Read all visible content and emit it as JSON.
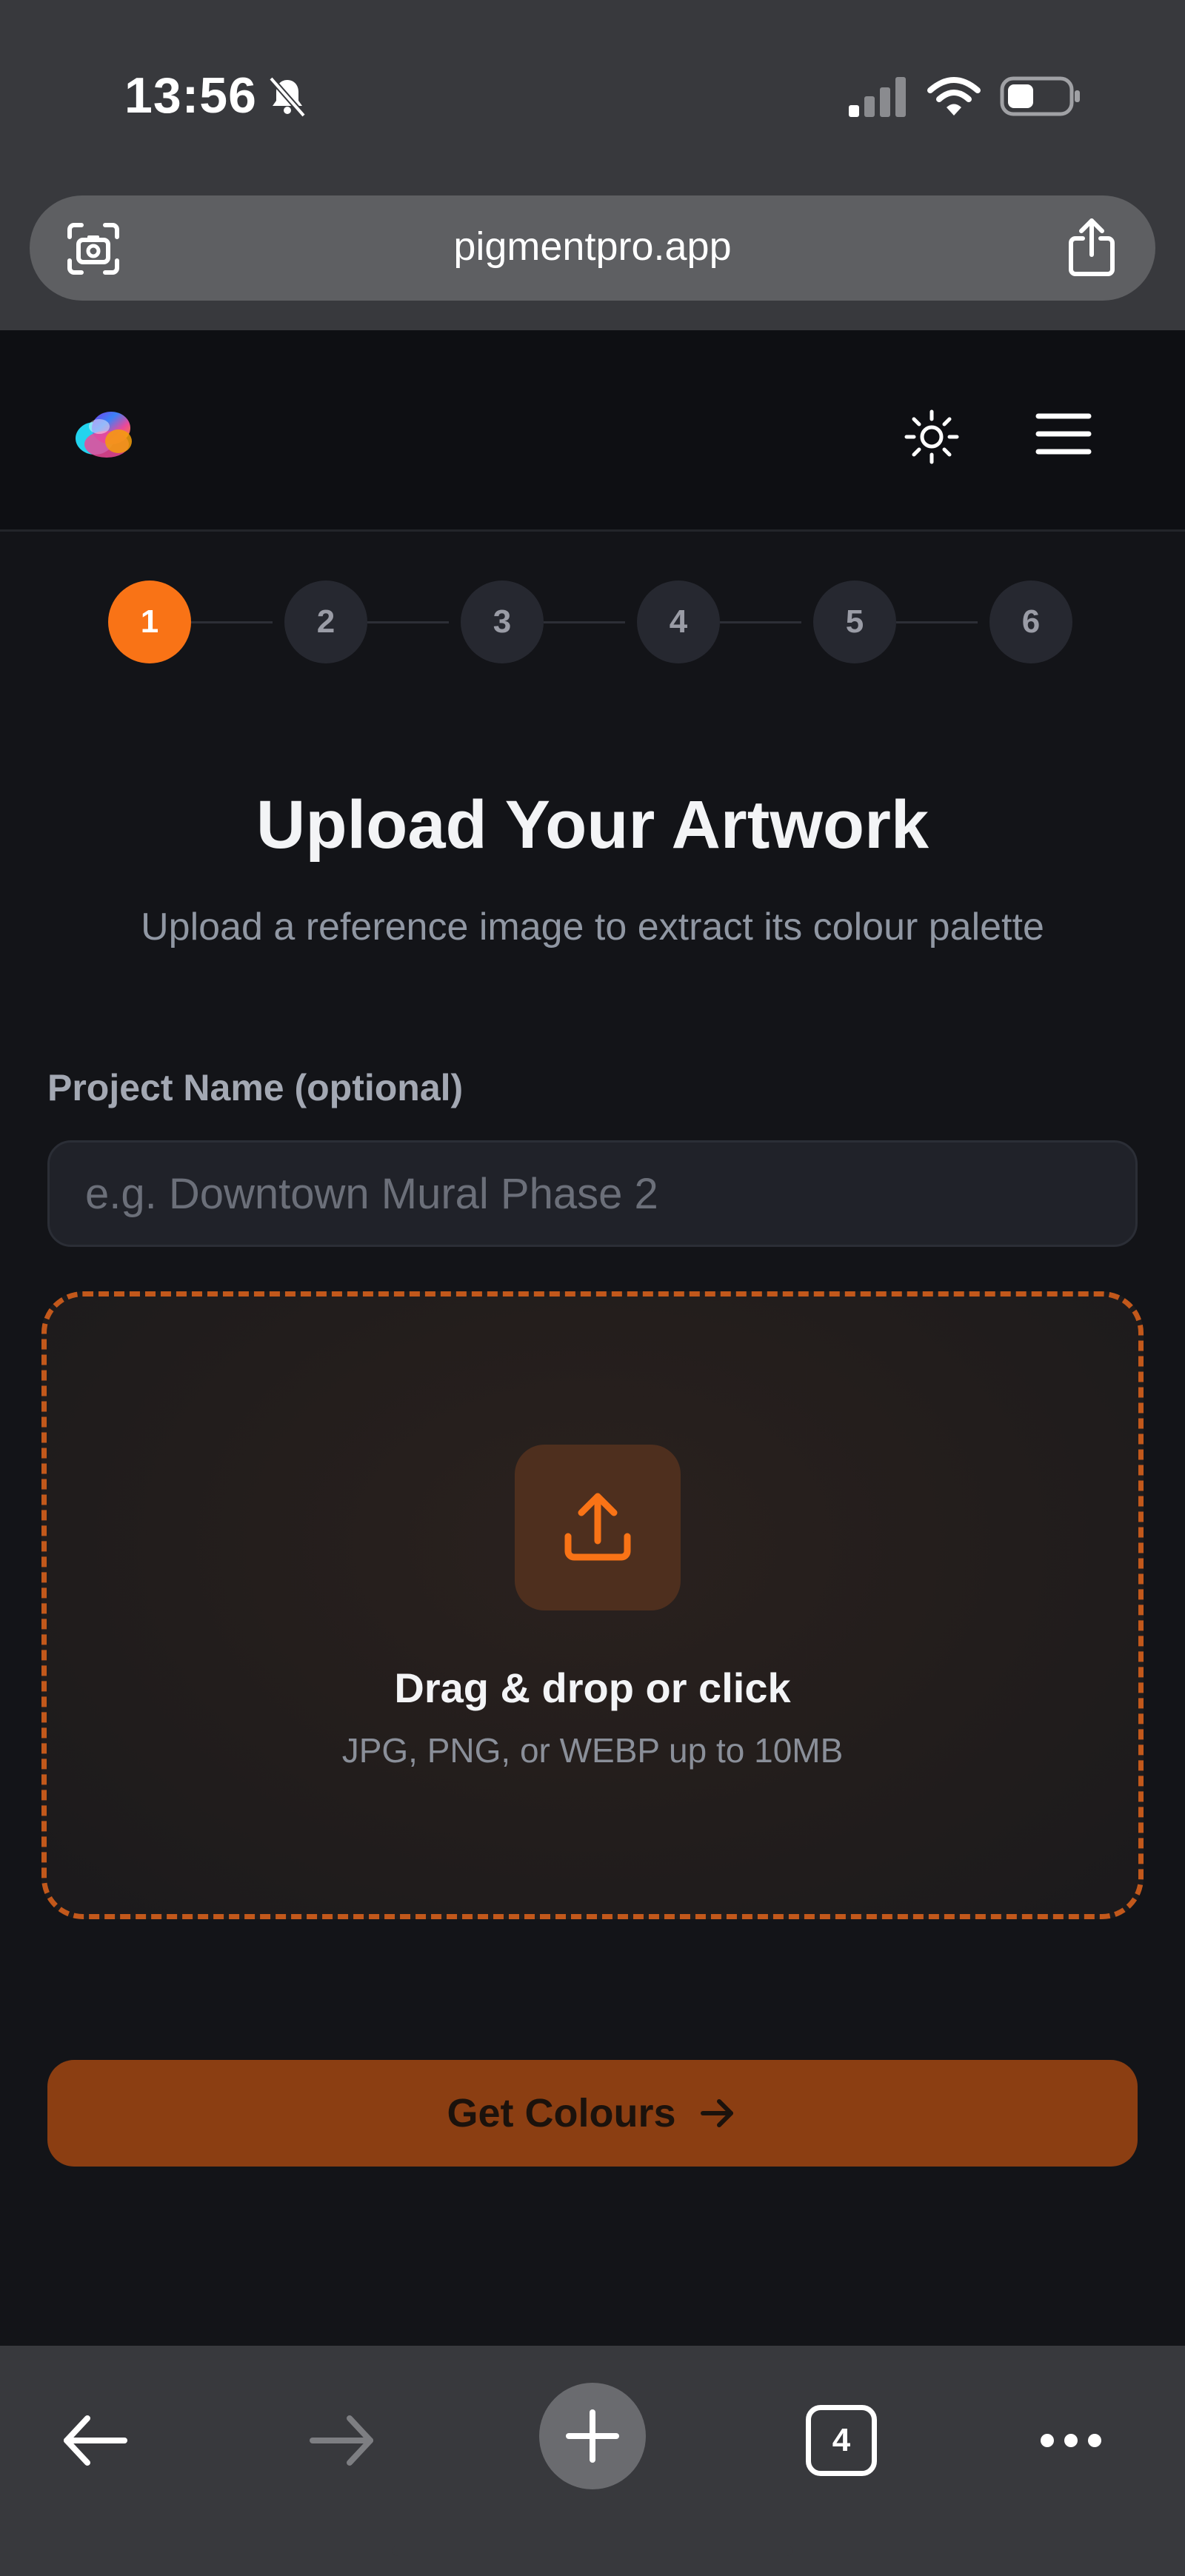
{
  "status_bar": {
    "time": "13:56"
  },
  "browser": {
    "url": "pigmentpro.app",
    "tab_count": "4"
  },
  "stepper": {
    "steps": [
      "1",
      "2",
      "3",
      "4",
      "5",
      "6"
    ],
    "active_step": 1
  },
  "page": {
    "title": "Upload Your Artwork",
    "subtitle": "Upload a reference image to extract its colour palette"
  },
  "project_name": {
    "label": "Project Name (optional)",
    "placeholder": "e.g. Downtown Mural Phase 2",
    "value": ""
  },
  "dropzone": {
    "title": "Drag & drop or click",
    "hint": "JPG, PNG, or WEBP up to 10MB",
    "icon": "upload-icon"
  },
  "cta": {
    "label": "Get Colours",
    "icon": "arrow-right-icon"
  },
  "colors": {
    "accent": "#f97316",
    "cta_background": "#8b3e12",
    "dropzone_border": "#c2581b",
    "app_background": "#131418",
    "browser_chrome": "#38393d"
  },
  "icons": {
    "status": [
      "bell-slash-icon",
      "cellular-signal-icon",
      "wifi-icon",
      "battery-icon"
    ],
    "url_bar": [
      "visual-lookup-icon",
      "share-icon"
    ],
    "header": [
      "app-logo-icon",
      "sun-icon",
      "hamburger-menu-icon"
    ],
    "toolbar": [
      "back-arrow-icon",
      "forward-arrow-icon",
      "plus-icon",
      "tabs-icon",
      "more-dots-icon"
    ]
  }
}
